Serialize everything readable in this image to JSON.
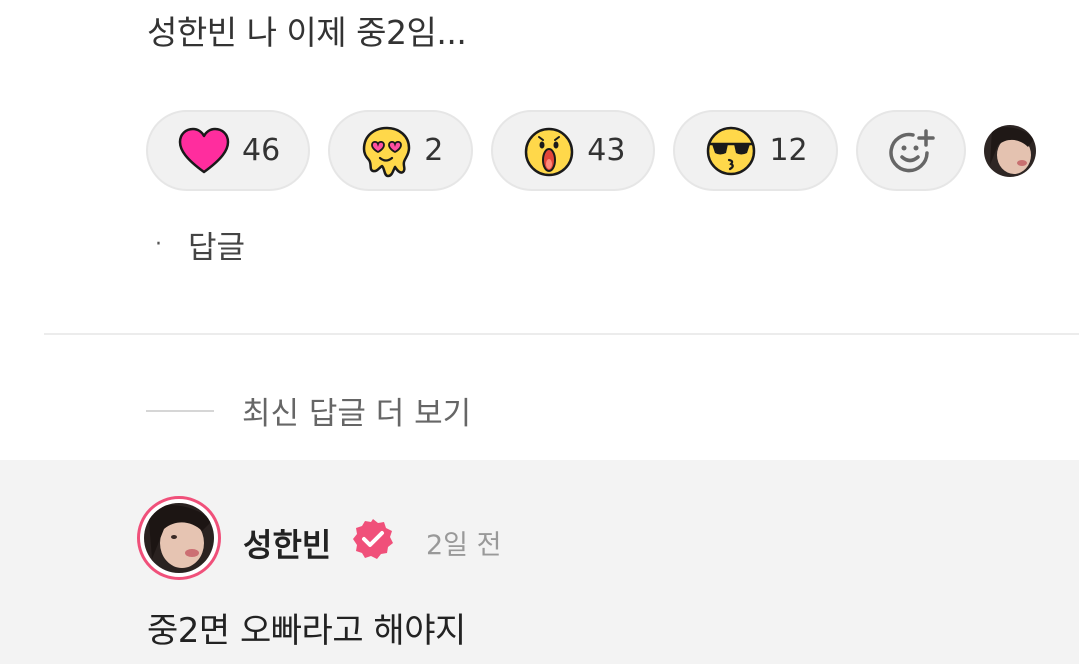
{
  "comment": {
    "text": "성한빈 나 이제 중2임..."
  },
  "reactions": [
    {
      "icon": "heart-emoji",
      "count": "46"
    },
    {
      "icon": "melting-love-emoji",
      "count": "2"
    },
    {
      "icon": "shocked-emoji",
      "count": "43"
    },
    {
      "icon": "sunglasses-kiss-emoji",
      "count": "12"
    }
  ],
  "add_reaction_icon": "add-reaction-icon",
  "actions": {
    "bullet": "·",
    "reply_label": "답글"
  },
  "more_replies_label": "최신 답글 더 보기",
  "reply": {
    "author": "성한빈",
    "time": "2일 전",
    "text": "중2면 오빠라고 해야지"
  },
  "colors": {
    "accent": "#f0507a",
    "heart": "#ff2d9e",
    "emoji_yellow": "#ffd84a",
    "reply_background": "#f3f3f3"
  }
}
